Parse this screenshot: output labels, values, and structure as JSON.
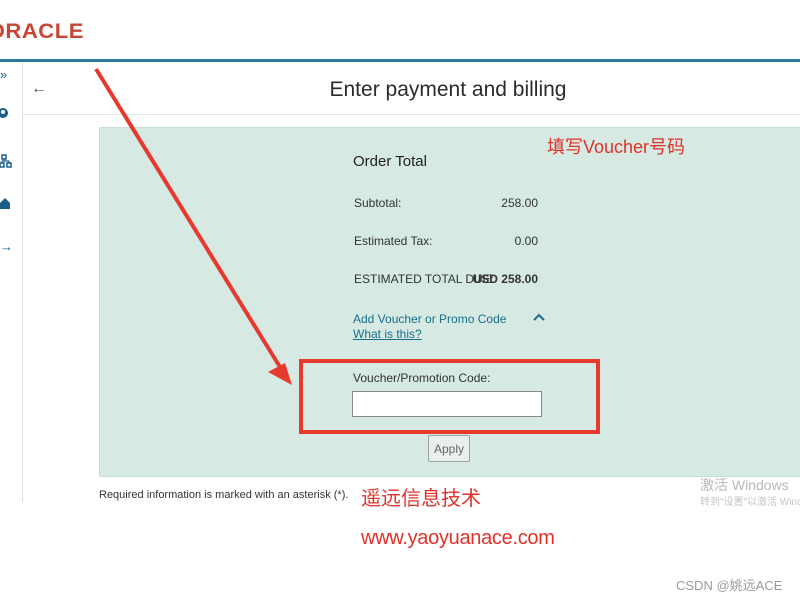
{
  "header": {
    "brand": "ORACLE"
  },
  "sidebar": {
    "icons": [
      "expand-icon",
      "user-icon",
      "hierarchy-icon",
      "home-icon",
      "arrow-right-icon"
    ]
  },
  "page": {
    "back_label": "←",
    "title": "Enter payment and billing"
  },
  "order": {
    "title": "Order Total",
    "rows": [
      {
        "label": "Subtotal:",
        "value": "258.00"
      },
      {
        "label": "Estimated Tax:",
        "value": "0.00"
      },
      {
        "label": "ESTIMATED TOTAL DUE:",
        "value": "USD 258.00"
      }
    ],
    "voucher_link": "Add Voucher or Promo Code",
    "what_link": "What is this?",
    "voucher_label": "Voucher/Promotion Code:",
    "voucher_value": "",
    "apply_label": "Apply"
  },
  "footer": {
    "required_note": "Required information is marked with an asterisk (*)."
  },
  "annotations": {
    "top": "填写Voucher号码",
    "mid": "遥远信息技术",
    "url": "www.yaoyuanace.com",
    "color": "#e0322b"
  },
  "watermarks": {
    "windows": "激活 Windows",
    "windows_sub": "转到\"设置\"以激活 Windows。",
    "csdn": "CSDN @姚远ACE"
  },
  "colors": {
    "accent": "#2a7a99",
    "panel": "#d6e9e3",
    "link": "#1a6f8a",
    "brand": "#c74634"
  }
}
